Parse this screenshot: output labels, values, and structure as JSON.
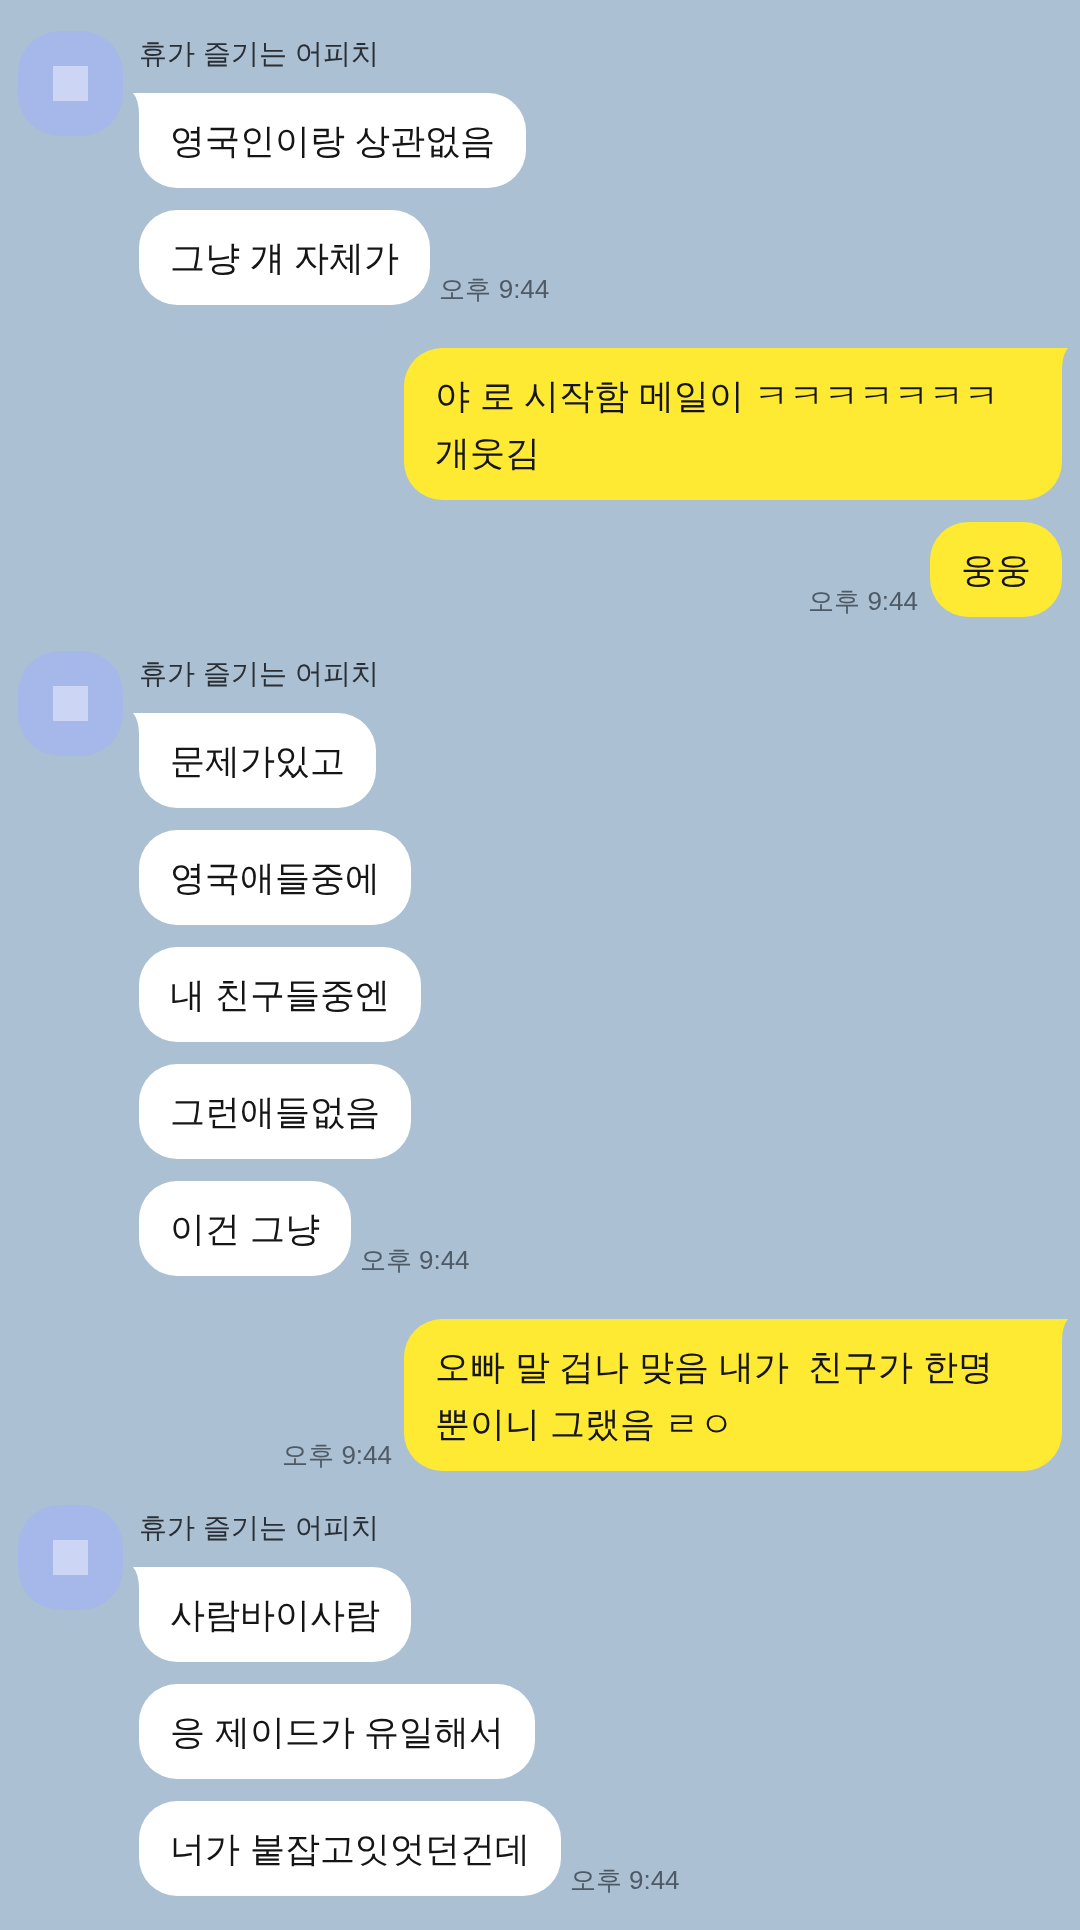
{
  "chat": {
    "groups": [
      {
        "kind": "received",
        "sender": "휴가 즐기는 어피치",
        "messages": [
          {
            "text": "영국인이랑 상관없음"
          },
          {
            "text": "그냥 걔 자체가"
          }
        ],
        "time": "오후 9:44"
      },
      {
        "kind": "sent",
        "messages": [
          {
            "text": "야 로 시작함 메일이 ㅋㅋㅋㅋㅋㅋㅋ 개웃김"
          },
          {
            "text": "웅웅"
          }
        ],
        "time": "오후 9:44"
      },
      {
        "kind": "received",
        "sender": "휴가 즐기는 어피치",
        "messages": [
          {
            "text": "문제가있고"
          },
          {
            "text": "영국애들중에"
          },
          {
            "text": "내 친구들중엔"
          },
          {
            "text": "그런애들없음"
          },
          {
            "text": "이건 그냥"
          }
        ],
        "time": "오후 9:44"
      },
      {
        "kind": "sent",
        "messages": [
          {
            "text": "오빠 말 겁나 맞음 내가  친구가 한명 뿐이니 그랬음 ㄹㅇ"
          }
        ],
        "time": "오후 9:44"
      },
      {
        "kind": "received",
        "sender": "휴가 즐기는 어피치",
        "messages": [
          {
            "text": "사람바이사람"
          },
          {
            "text": "응 제이드가 유일해서"
          },
          {
            "text": "너가 붙잡고잇엇던건데"
          }
        ],
        "time": "오후 9:44"
      }
    ]
  }
}
